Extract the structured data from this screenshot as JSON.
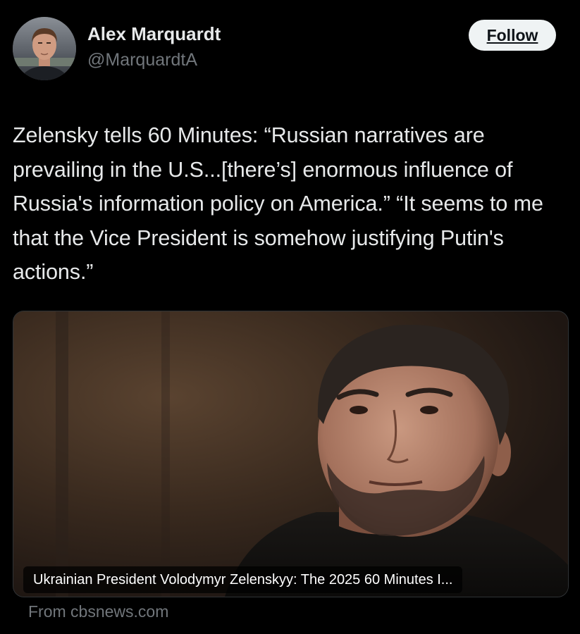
{
  "author": {
    "name": "Alex Marquardt",
    "handle": "@MarquardtA"
  },
  "follow_button": {
    "label": "Follow"
  },
  "tweet": {
    "text": "Zelensky tells 60 Minutes: “Russian narratives are prevailing in the U.S...[there’s] enormous influence of Russia's information policy on America.” “It seems to me that the Vice President is somehow justifying Putin's actions.”"
  },
  "media": {
    "caption": "Ukrainian President Volodymyr Zelenskyy: The 2025 60 Minutes I...",
    "source": "From cbsnews.com"
  },
  "colors": {
    "background": "#000000",
    "primary_text": "#e7e9ea",
    "secondary_text": "#71767b",
    "follow_bg": "#eff3f4",
    "follow_text": "#0f1419"
  }
}
